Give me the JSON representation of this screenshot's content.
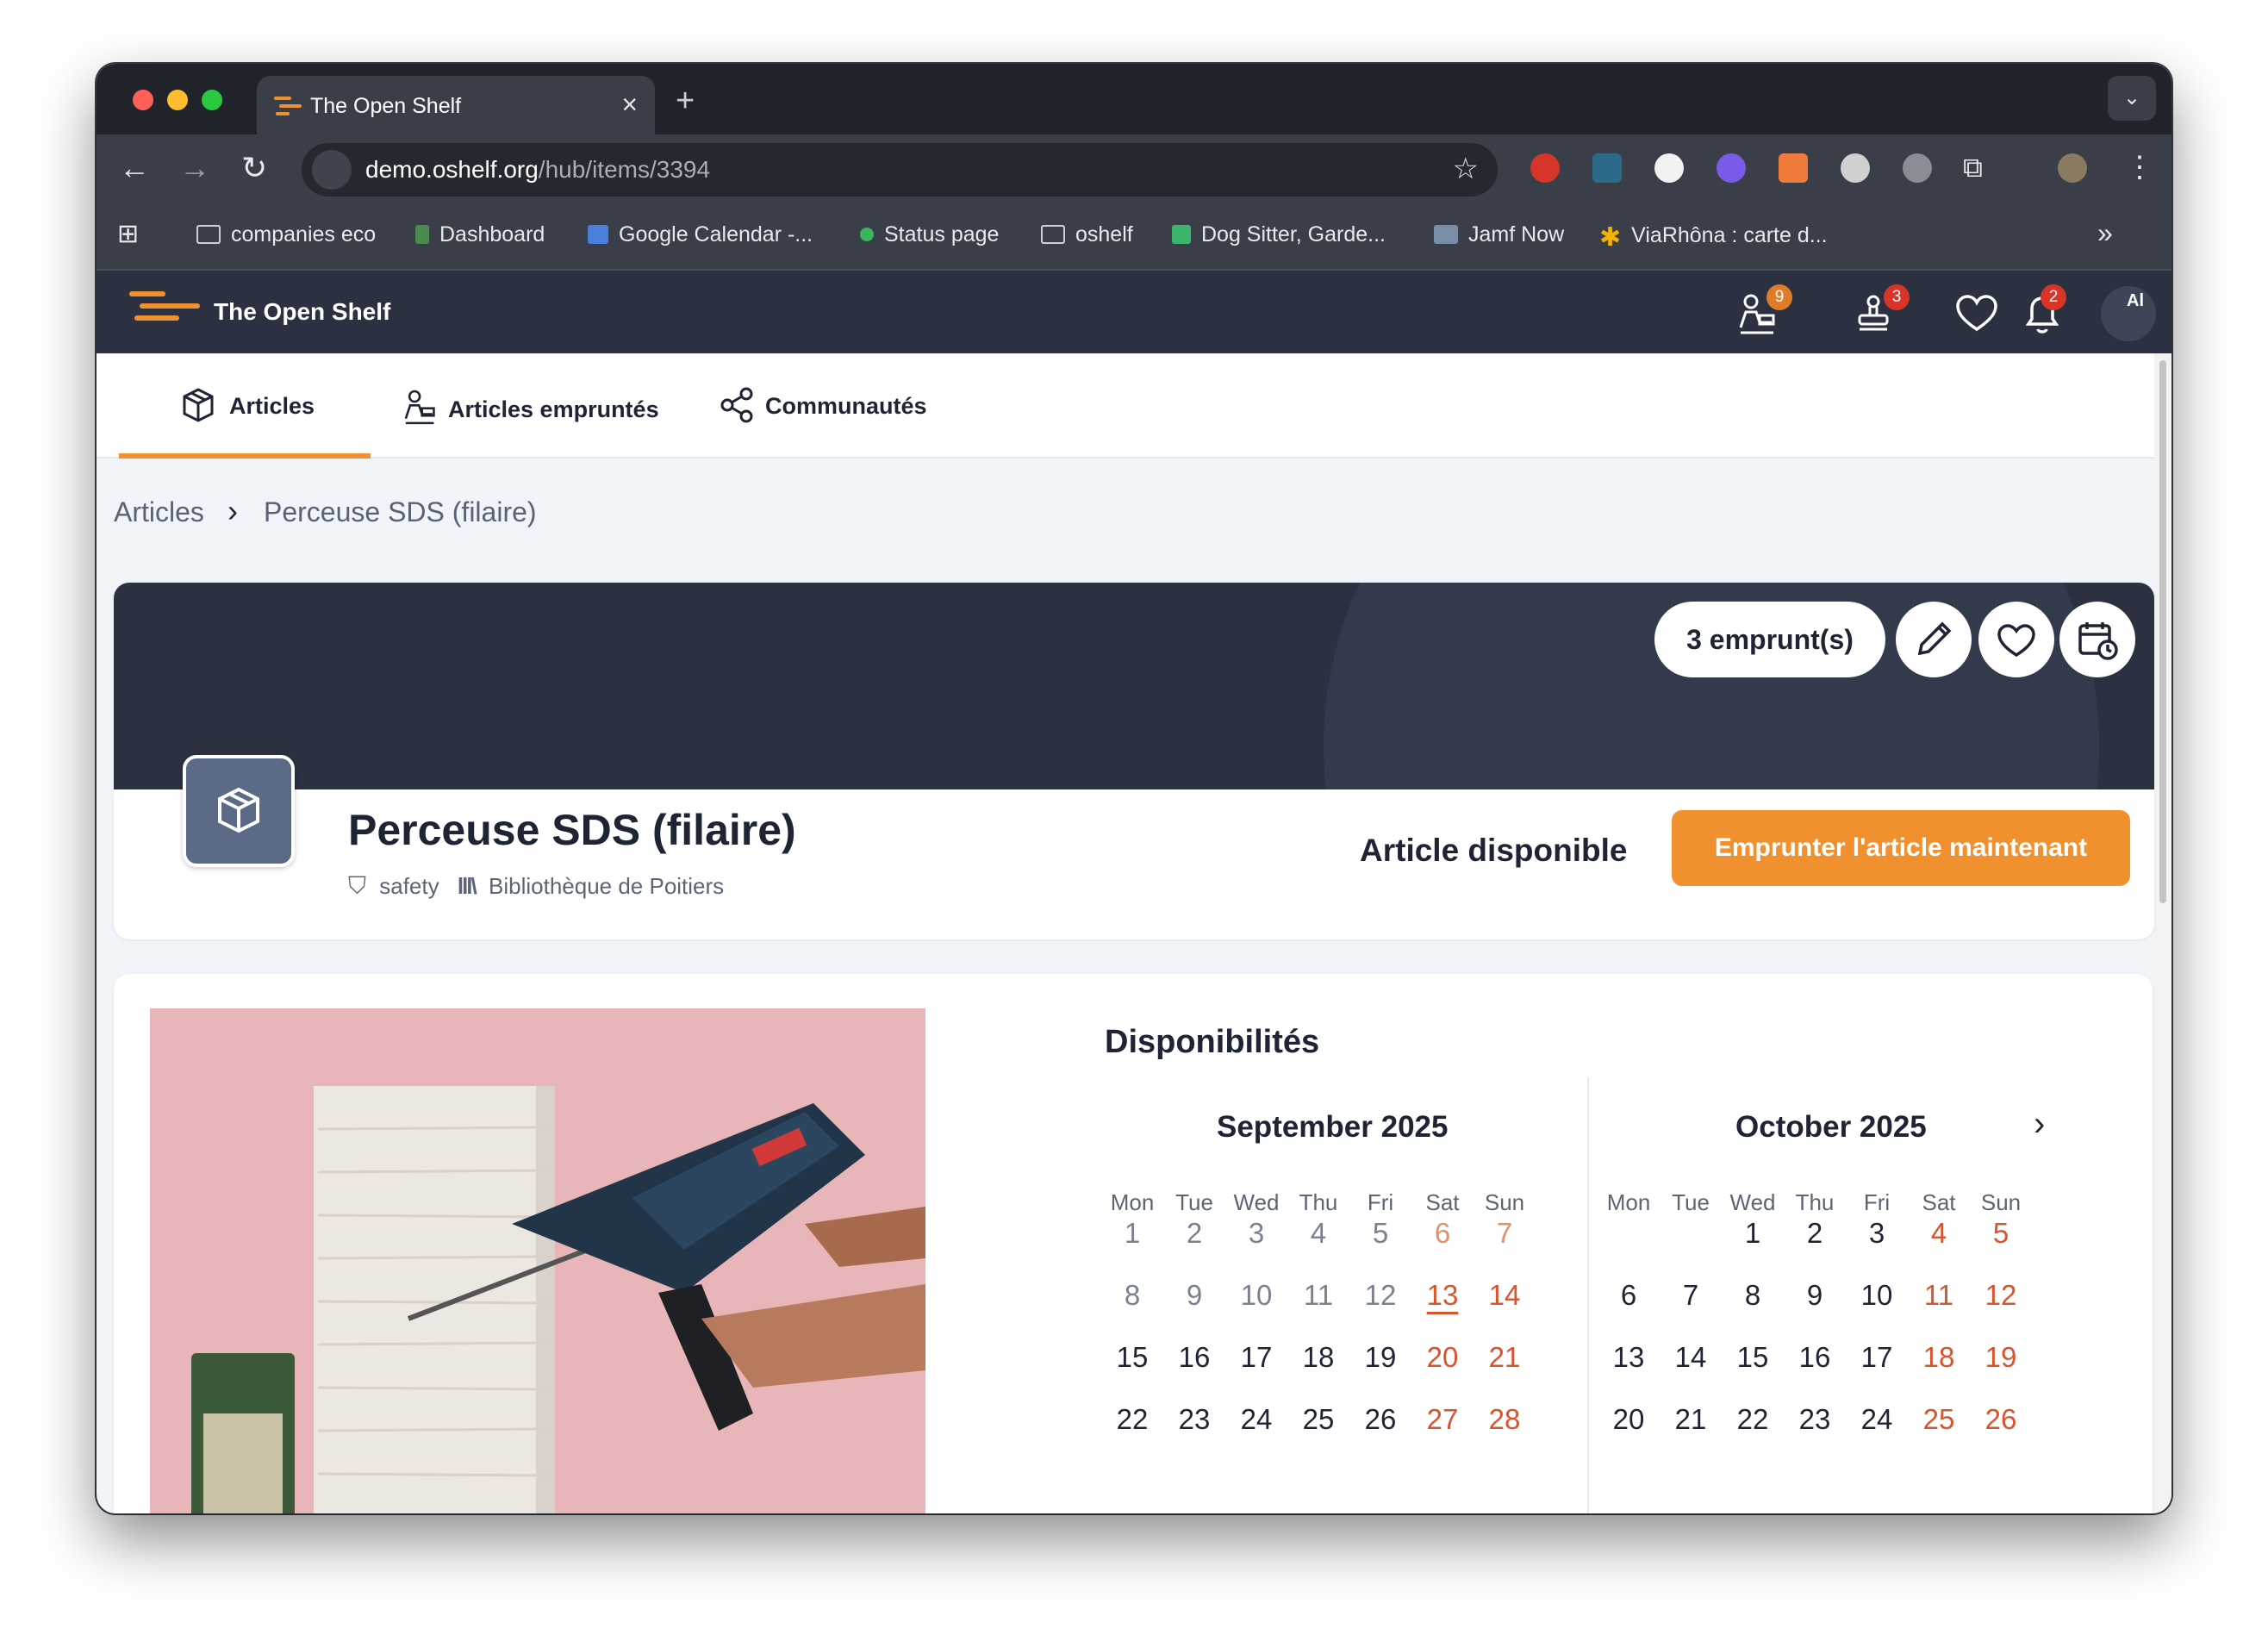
{
  "browser": {
    "tab_title": "The Open Shelf",
    "tab_close": "×",
    "new_tab": "+",
    "url_host": "demo.oshelf.org",
    "url_path": "/hub/items/3394",
    "bookmarks": [
      {
        "label": "companies eco",
        "icon": "folder-icon"
      },
      {
        "label": "Dashboard",
        "icon": "dashboard-icon"
      },
      {
        "label": "Google Calendar -...",
        "icon": "calendar-icon"
      },
      {
        "label": "Status page",
        "icon": "status-dot-icon"
      },
      {
        "label": "oshelf",
        "icon": "folder-icon"
      },
      {
        "label": "Dog Sitter, Garde...",
        "icon": "rover-icon"
      },
      {
        "label": "Jamf Now",
        "icon": "jamf-icon"
      },
      {
        "label": "ViaRhôna : carte d...",
        "icon": "star-icon"
      }
    ],
    "bookmarks_more": "»"
  },
  "app": {
    "title": "The Open Shelf",
    "badges": {
      "loans": "9",
      "stamps": "3",
      "notifications": "2"
    },
    "avatar_text": "Al"
  },
  "nav": {
    "tabs": [
      {
        "label": "Articles"
      },
      {
        "label": "Articles empruntés"
      },
      {
        "label": "Communautés"
      }
    ]
  },
  "breadcrumb": {
    "root": "Articles",
    "sep": "›",
    "current": "Perceuse SDS (filaire)"
  },
  "item": {
    "loans_pill": "3 emprunt(s)",
    "title": "Perceuse SDS (filaire)",
    "category": "safety",
    "library": "Bibliothèque de Poitiers",
    "status": "Article disponible",
    "borrow_label": "Emprunter l'article maintenant"
  },
  "availability": {
    "title": "Disponibilités",
    "weekdays": [
      "Mon",
      "Tue",
      "Wed",
      "Thu",
      "Fri",
      "Sat",
      "Sun"
    ],
    "months": [
      {
        "name": "September 2025",
        "weeks": [
          [
            "1",
            "2",
            "3",
            "4",
            "5",
            "6",
            "7"
          ],
          [
            "8",
            "9",
            "10",
            "11",
            "12",
            "13",
            "14"
          ],
          [
            "15",
            "16",
            "17",
            "18",
            "19",
            "20",
            "21"
          ],
          [
            "22",
            "23",
            "24",
            "25",
            "26",
            "27",
            "28"
          ]
        ]
      },
      {
        "name": "October 2025",
        "weeks": [
          [
            "",
            "",
            "1",
            "2",
            "3",
            "4",
            "5"
          ],
          [
            "6",
            "7",
            "8",
            "9",
            "10",
            "11",
            "12"
          ],
          [
            "13",
            "14",
            "15",
            "16",
            "17",
            "18",
            "19"
          ],
          [
            "20",
            "21",
            "22",
            "23",
            "24",
            "25",
            "26"
          ]
        ]
      }
    ]
  },
  "colors": {
    "accent": "#f0902f",
    "navy": "#2b3140",
    "weekend": "#d9532c"
  }
}
